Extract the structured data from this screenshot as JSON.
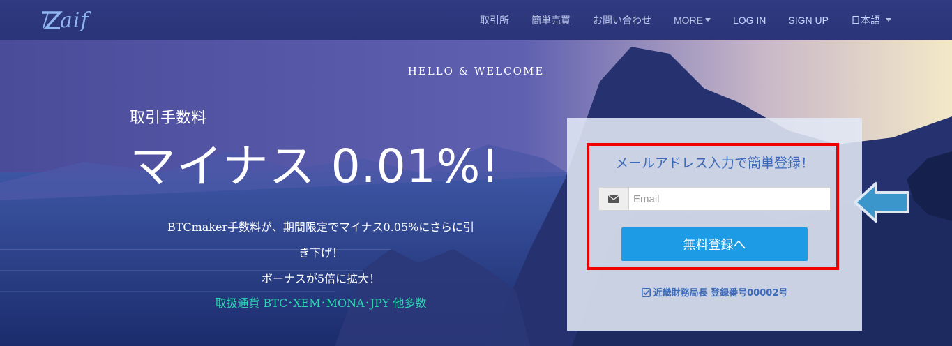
{
  "brand": {
    "logo_text": "aif"
  },
  "nav": {
    "items": [
      "取引所",
      "簡単売買",
      "お問い合わせ",
      "MORE"
    ],
    "login": "LOG IN",
    "signup": "SIGN UP",
    "language": "日本語"
  },
  "hero": {
    "greeting": "HELLO & WELCOME",
    "fee_label": "取引手数料",
    "headline": "マイナス 0.01%!",
    "promo_lines": [
      "BTCmaker手数料が、期間限定でマイナス0.05%にさらに引",
      "き下げ！",
      "ボーナスが5倍に拡大！"
    ],
    "currencies": "取扱通貨 BTC･XEM･MONA･JPY 他多数"
  },
  "signup": {
    "title": "メールアドレス入力で簡単登録！",
    "email_placeholder": "Email",
    "email_value": "",
    "submit_label": "無料登録へ",
    "license": "近畿財務局長 登録番号00002号"
  },
  "colors": {
    "navbar": "#2f3a80",
    "button": "#1d9be4",
    "highlight_border": "#ee0000",
    "panel_text": "#3c6ab8",
    "currency_text": "#2fd6b2",
    "arrow": "#3b96cc"
  },
  "icons": {
    "email_addon": "envelope-icon",
    "license": "check-square-icon",
    "pointer": "left-arrow-icon",
    "caret": "caret-down-icon"
  }
}
